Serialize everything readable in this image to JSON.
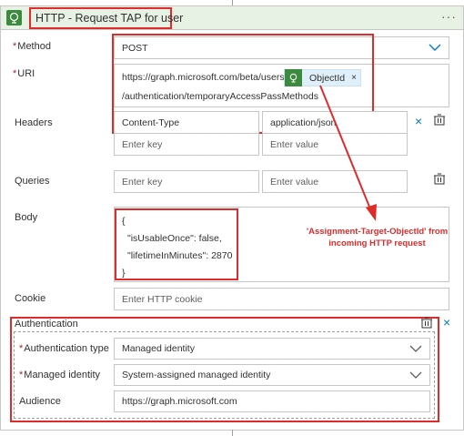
{
  "header": {
    "title": "HTTP - Request TAP for user",
    "more": "···"
  },
  "method": {
    "label": "Method",
    "value": "POST"
  },
  "uri": {
    "label": "URI",
    "line1": "https://graph.microsoft.com/beta/users/",
    "token": "ObjectId",
    "token_remove": "×",
    "line2": "/authentication/temporaryAccessPassMethods"
  },
  "headers": {
    "label": "Headers",
    "key": "Content-Type",
    "value": "application/json",
    "key_placeholder": "Enter key",
    "value_placeholder": "Enter value",
    "remove": "×"
  },
  "queries": {
    "label": "Queries",
    "key_placeholder": "Enter key",
    "value_placeholder": "Enter value"
  },
  "body": {
    "label": "Body",
    "lines": [
      "{",
      "\"isUsableOnce\": false,",
      "\"lifetimeInMinutes\": 2870",
      "}"
    ]
  },
  "cookie": {
    "label": "Cookie",
    "placeholder": "Enter HTTP cookie"
  },
  "authentication": {
    "label": "Authentication",
    "remove": "×",
    "type_label": "Authentication type",
    "type_value": "Managed identity",
    "identity_label": "Managed identity",
    "identity_value": "System-assigned managed identity",
    "audience_label": "Audience",
    "audience_value": "https://graph.microsoft.com"
  },
  "annotation": {
    "line1": "'Assignment-Target-ObjectId' from",
    "line2": "incoming HTTP request"
  },
  "colors": {
    "highlight": "#e02b2b",
    "accent": "#0078d4",
    "header_bg": "#e7f1e4",
    "icon_green": "#3b8a3e"
  },
  "required_marker": "*"
}
